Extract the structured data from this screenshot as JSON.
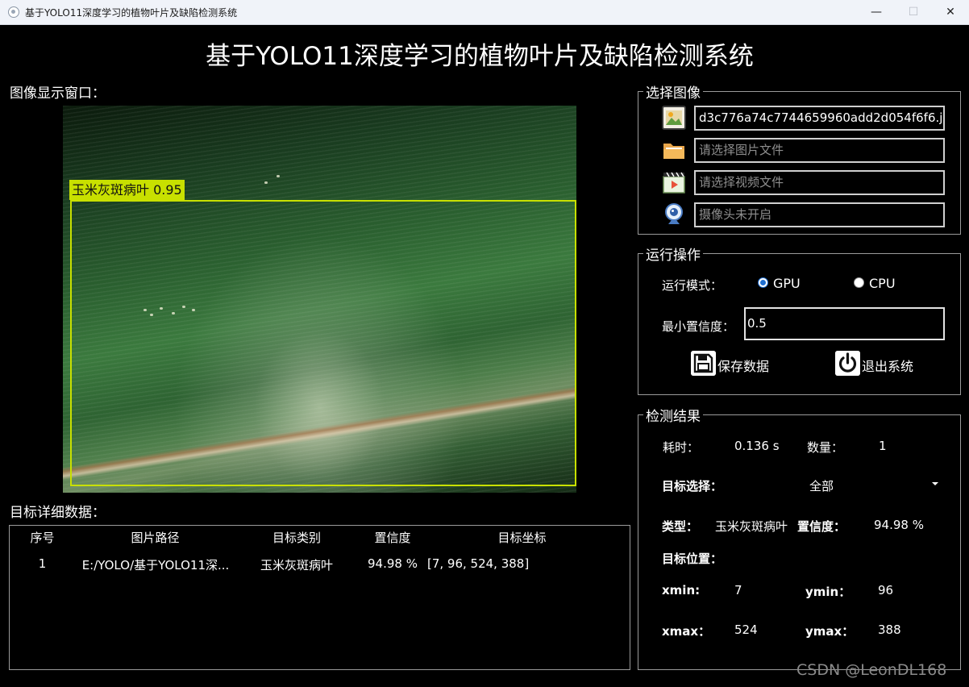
{
  "window": {
    "title": "基于YOLO11深度学习的植物叶片及缺陷检测系统",
    "minimize_glyph": "—",
    "maximize_glyph": "☐",
    "close_glyph": "✕"
  },
  "header": {
    "title": "基于YOLO11深度学习的植物叶片及缺陷检测系统"
  },
  "viewer": {
    "label": "图像显示窗口：",
    "detection": {
      "label": "玉米灰斑病叶 0.95",
      "color": "#c8e000"
    }
  },
  "details": {
    "label": "目标详细数据：",
    "columns": [
      "序号",
      "图片路径",
      "目标类别",
      "置信度",
      "目标坐标"
    ],
    "rows": [
      {
        "index": "1",
        "path": "E:/YOLO/基于YOLO11深...",
        "class": "玉米灰斑病叶",
        "confidence": "94.98 %",
        "coords": "[7, 96, 524, 388]"
      }
    ]
  },
  "select_image": {
    "title": "选择图像",
    "image_file": {
      "value": "d3c776a74c7744659960add2d054f6f6.jpg",
      "icon": "image-icon"
    },
    "folder": {
      "placeholder": "请选择图片文件",
      "icon": "folder-icon"
    },
    "video": {
      "placeholder": "请选择视频文件",
      "icon": "video-icon"
    },
    "camera": {
      "placeholder": "摄像头未开启",
      "icon": "webcam-icon"
    }
  },
  "run_ops": {
    "title": "运行操作",
    "mode_label": "运行模式：",
    "gpu_label": "GPU",
    "cpu_label": "CPU",
    "selected_mode": "GPU",
    "min_conf_label": "最小置信度：",
    "min_conf_value": "0.5",
    "save_label": "保存数据",
    "exit_label": "退出系统"
  },
  "results": {
    "title": "检测结果",
    "time_label": "耗时：",
    "time_value": "0.136 s",
    "count_label": "数量：",
    "count_value": "1",
    "target_select_label": "目标选择：",
    "target_select_value": "全部",
    "type_label": "类型：",
    "type_value": "玉米灰斑病叶",
    "conf_label": "置信度：",
    "conf_value": "94.98 %",
    "position_label": "目标位置：",
    "xmin_label": "xmin:",
    "xmin_value": "7",
    "ymin_label": "ymin：",
    "ymin_value": "96",
    "xmax_label": "xmax：",
    "xmax_value": "524",
    "ymax_label": "ymax：",
    "ymax_value": "388"
  },
  "watermark": "CSDN @LeonDL168",
  "colors": {
    "background": "#000000",
    "box": "#c8e000",
    "radio_accent": "#1f6fd1"
  }
}
